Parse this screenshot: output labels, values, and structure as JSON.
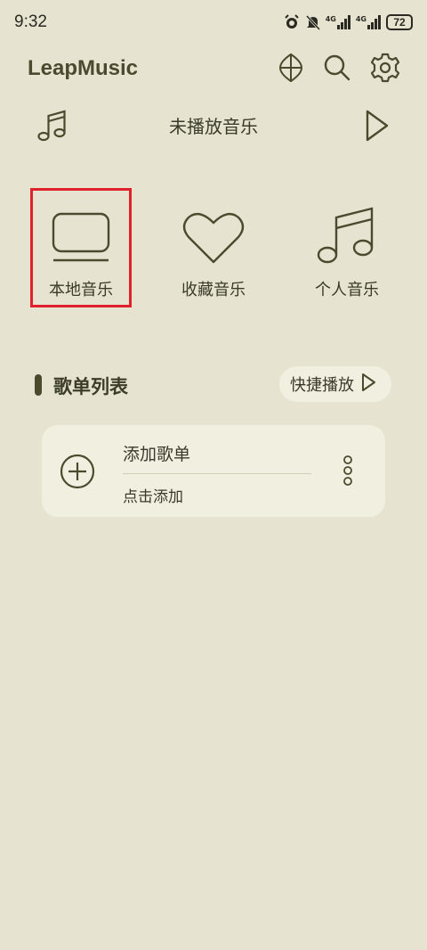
{
  "status_bar": {
    "time": "9:32",
    "signal1_label": "4G",
    "signal2_label": "4G",
    "battery": "72"
  },
  "header": {
    "app_title": "LeapMusic",
    "icons": [
      "shuffle-icon",
      "search-icon",
      "settings-icon"
    ]
  },
  "now_playing": {
    "title": "未播放音乐"
  },
  "shortcuts": [
    {
      "label": "本地音乐",
      "icon": "local-music-icon",
      "highlighted": true
    },
    {
      "label": "收藏音乐",
      "icon": "heart-icon",
      "highlighted": false
    },
    {
      "label": "个人音乐",
      "icon": "music-note-icon",
      "highlighted": false
    }
  ],
  "playlist_section": {
    "title": "歌单列表",
    "quick_play_label": "快捷播放"
  },
  "playlist_card": {
    "title": "添加歌单",
    "subtitle": "点击添加"
  },
  "colors": {
    "background": "#e6e4d0",
    "card": "#f1efe0",
    "accent": "#4b4a2e",
    "highlight": "#e0202a"
  }
}
